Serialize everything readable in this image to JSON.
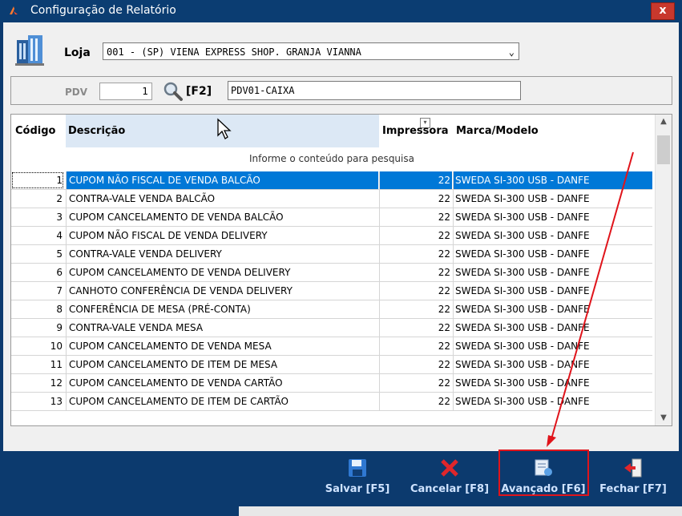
{
  "window": {
    "title": "Configuração de Relatório",
    "close_label": "x"
  },
  "loja": {
    "label": "Loja",
    "value": "001 - (SP) VIENA EXPRESS  SHOP. GRANJA VIANNA"
  },
  "pdv": {
    "label": "PDV",
    "number": "1",
    "shortcut": "[F2]",
    "caixa": "PDV01-CAIXA"
  },
  "grid": {
    "columns": [
      "Código",
      "Descrição",
      "Impressora",
      "Marca/Modelo"
    ],
    "info_text": "Informe o conteúdo para pesquisa",
    "rows": [
      {
        "codigo": "1",
        "descricao": "CUPOM NÃO FISCAL DE VENDA BALCÃO",
        "impressora": "22",
        "marca": "SWEDA SI-300 USB - DANFE"
      },
      {
        "codigo": "2",
        "descricao": "CONTRA-VALE VENDA BALCÃO",
        "impressora": "22",
        "marca": "SWEDA SI-300 USB - DANFE"
      },
      {
        "codigo": "3",
        "descricao": "CUPOM CANCELAMENTO DE VENDA BALCÃO",
        "impressora": "22",
        "marca": "SWEDA SI-300 USB - DANFE"
      },
      {
        "codigo": "4",
        "descricao": "CUPOM NÃO FISCAL DE VENDA DELIVERY",
        "impressora": "22",
        "marca": "SWEDA SI-300 USB - DANFE"
      },
      {
        "codigo": "5",
        "descricao": "CONTRA-VALE VENDA DELIVERY",
        "impressora": "22",
        "marca": "SWEDA SI-300 USB - DANFE"
      },
      {
        "codigo": "6",
        "descricao": "CUPOM CANCELAMENTO DE VENDA DELIVERY",
        "impressora": "22",
        "marca": "SWEDA SI-300 USB - DANFE"
      },
      {
        "codigo": "7",
        "descricao": "CANHOTO CONFERÊNCIA DE VENDA DELIVERY",
        "impressora": "22",
        "marca": "SWEDA SI-300 USB - DANFE"
      },
      {
        "codigo": "8",
        "descricao": "CONFERÊNCIA DE MESA (PRÉ-CONTA)",
        "impressora": "22",
        "marca": "SWEDA SI-300 USB - DANFE"
      },
      {
        "codigo": "9",
        "descricao": "CONTRA-VALE VENDA MESA",
        "impressora": "22",
        "marca": "SWEDA SI-300 USB - DANFE"
      },
      {
        "codigo": "10",
        "descricao": "CUPOM CANCELAMENTO DE VENDA MESA",
        "impressora": "22",
        "marca": "SWEDA SI-300 USB - DANFE"
      },
      {
        "codigo": "11",
        "descricao": "CUPOM CANCELAMENTO DE ITEM DE MESA",
        "impressora": "22",
        "marca": "SWEDA SI-300 USB - DANFE"
      },
      {
        "codigo": "12",
        "descricao": "CUPOM CANCELAMENTO DE VENDA CARTÃO",
        "impressora": "22",
        "marca": "SWEDA SI-300 USB - DANFE"
      },
      {
        "codigo": "13",
        "descricao": "CUPOM CANCELAMENTO DE ITEM DE CARTÃO",
        "impressora": "22",
        "marca": "SWEDA SI-300 USB - DANFE"
      }
    ]
  },
  "toolbar": {
    "salvar": "Salvar [F5]",
    "cancelar": "Cancelar [F8]",
    "avancado": "Avançado [F6]",
    "fechar": "Fechar [F7]"
  },
  "icons": {
    "app": "app-icon",
    "store": "store-building-icon",
    "search": "search-icon",
    "save": "floppy-disk-icon",
    "cancel": "red-x-icon",
    "advanced": "settings-document-icon",
    "close": "exit-door-icon"
  },
  "colors": {
    "titlebar": "#0b3d72",
    "selection": "#0078d7",
    "highlight_box": "#e0141b",
    "bottombar": "#0c3a6e"
  }
}
